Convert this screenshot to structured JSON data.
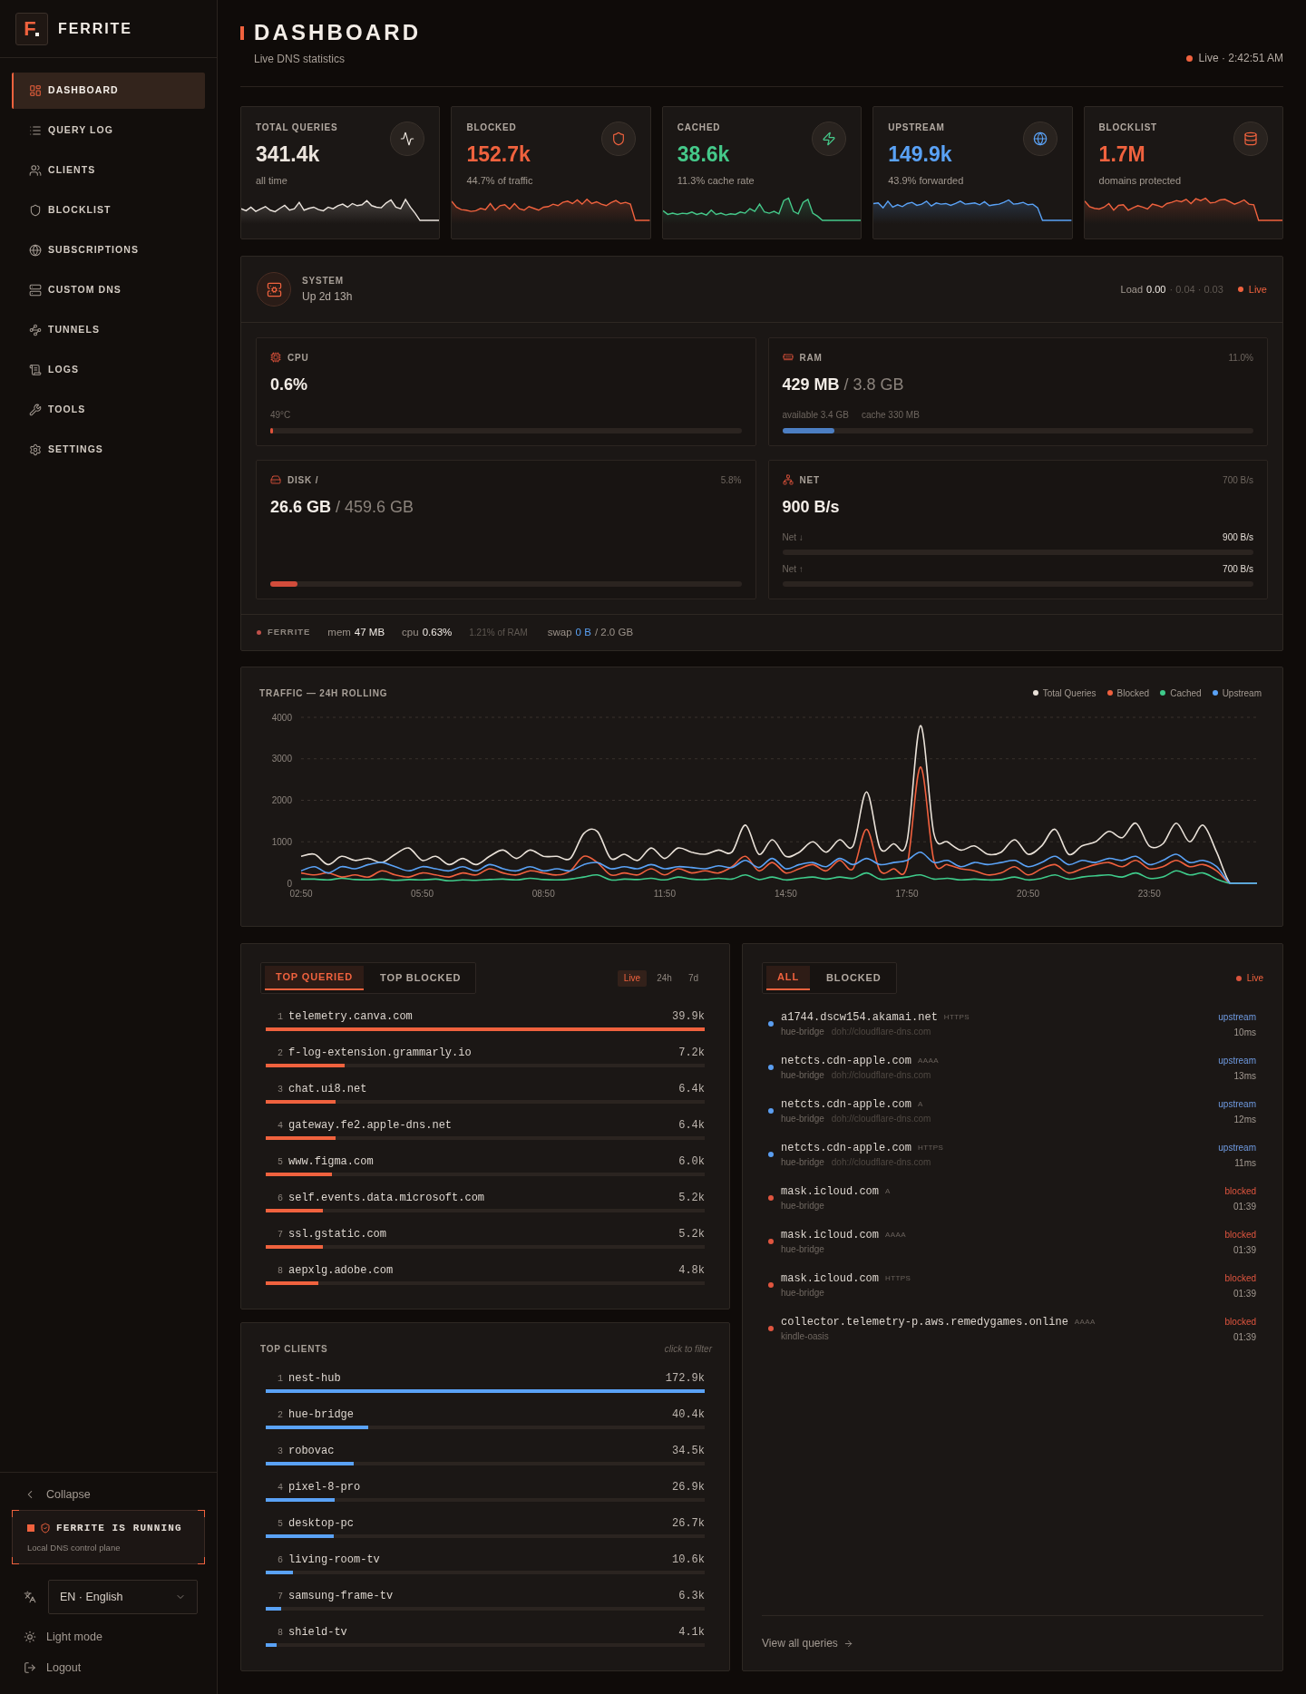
{
  "sidebar": {
    "brand": {
      "logo_letter": "F",
      "name": "FERRITE"
    },
    "nav": [
      {
        "label": "DASHBOARD",
        "selected": true
      },
      {
        "label": "QUERY LOG",
        "selected": false
      },
      {
        "label": "CLIENTS",
        "selected": false
      },
      {
        "label": "BLOCKLIST",
        "selected": false
      },
      {
        "label": "SUBSCRIPTIONS",
        "selected": false
      },
      {
        "label": "CUSTOM DNS",
        "selected": false
      },
      {
        "label": "TUNNELS",
        "selected": false
      },
      {
        "label": "LOGS",
        "selected": false
      },
      {
        "label": "TOOLS",
        "selected": false
      },
      {
        "label": "SETTINGS",
        "selected": false
      }
    ],
    "collapse": "Collapse",
    "status": {
      "title": "FERRITE IS RUNNING",
      "subtitle": "Local DNS control plane",
      "running": true
    },
    "language": {
      "value": "EN · English"
    },
    "theme_toggle": "Light mode",
    "logout": "Logout"
  },
  "header": {
    "title": "DASHBOARD",
    "subtitle": "Live DNS statistics",
    "live": "Live · 2:42:51 AM"
  },
  "stats": [
    {
      "label": "TOTAL QUERIES",
      "value": "341.4k",
      "note": "all time",
      "color": "#ece5de"
    },
    {
      "label": "BLOCKED",
      "value": "152.7k",
      "note": "44.7% of traffic",
      "color": "#f0623e"
    },
    {
      "label": "CACHED",
      "value": "38.6k",
      "note": "11.3% cache rate",
      "color": "#45c98a"
    },
    {
      "label": "UPSTREAM",
      "value": "149.9k",
      "note": "43.9% forwarded",
      "color": "#5aa2f6"
    },
    {
      "label": "BLOCKLIST",
      "value": "1.7M",
      "note": "domains protected",
      "color": "#f0623e"
    }
  ],
  "system": {
    "title": "SYSTEM",
    "uptime": "Up 2d 13h",
    "load": {
      "label": "Load",
      "current": "0.00",
      "rest": "· 0.04 · 0.03"
    },
    "live": "Live",
    "metrics": [
      {
        "kind": "gauge",
        "label": "CPU",
        "value": "0.6%",
        "notes": [
          "49°C"
        ],
        "level": 0.006,
        "color": "#e0533b"
      },
      {
        "kind": "gauge",
        "label": "RAM",
        "percent": "11.0%",
        "value": "429 MB",
        "total": "/ 3.8 GB",
        "notes": [
          "available 3.4 GB",
          "cache 330 MB"
        ],
        "level": 0.11,
        "color": "#4c7ec2"
      },
      {
        "kind": "gauge",
        "label": "DISK /",
        "percent": "5.8%",
        "value": "26.6 GB",
        "total": "/ 459.6 GB",
        "level": 0.058,
        "color": "#d24c3b"
      },
      {
        "kind": "rates",
        "label": "NET",
        "percent": "700 B/s",
        "value": "900 B/s",
        "rates": [
          {
            "label": "Net ↓",
            "reading": "900 B/s"
          },
          {
            "label": "Net ↑",
            "reading": "700 B/s"
          }
        ]
      }
    ],
    "process": {
      "name": "FERRITE",
      "stats": [
        {
          "label": "mem",
          "value": "47 MB"
        },
        {
          "label": "cpu",
          "value": "0.63%"
        }
      ],
      "note": "1.21% of RAM",
      "swap": {
        "label": "swap",
        "used": "0 B",
        "total": "/ 2.0 GB"
      }
    }
  },
  "traffic": {
    "chart_data": {
      "type": "line",
      "title": "TRAFFIC — 24H ROLLING",
      "grid": true,
      "categories": [
        "02:50",
        null,
        null,
        null,
        null,
        null,
        null,
        null,
        null,
        "05:50",
        null,
        null,
        null,
        null,
        null,
        null,
        null,
        null,
        "08:50",
        null,
        null,
        null,
        null,
        null,
        null,
        null,
        null,
        "11:50",
        null,
        null,
        null,
        null,
        null,
        null,
        null,
        null,
        "14:50",
        null,
        null,
        null,
        null,
        null,
        null,
        null,
        null,
        "17:50",
        null,
        null,
        null,
        null,
        null,
        null,
        null,
        null,
        "20:50",
        null,
        null,
        null,
        null,
        null,
        null,
        null,
        null,
        "23:50",
        null,
        null,
        null,
        null,
        null,
        null,
        null,
        null
      ],
      "ylim": [
        0,
        4000
      ],
      "yticks": [
        0,
        1000,
        2000,
        3000,
        4000
      ],
      "series": [
        {
          "name": "Total Queries",
          "color": "#e9e1d8",
          "values": [
            650,
            700,
            450,
            650,
            550,
            600,
            500,
            700,
            850,
            550,
            650,
            450,
            600,
            450,
            650,
            800,
            600,
            800,
            650,
            650,
            600,
            1200,
            1250,
            600,
            700,
            550,
            850,
            600,
            850,
            750,
            700,
            800,
            750,
            1400,
            700,
            1050,
            650,
            750,
            1000,
            750,
            1050,
            900,
            2200,
            850,
            950,
            1000,
            3800,
            1200,
            1000,
            800,
            900,
            700,
            750,
            1050,
            700,
            900,
            1300,
            700,
            900,
            1000,
            1250,
            1100,
            1450,
            900,
            950,
            1450,
            1000,
            1400,
            750,
            0,
            0,
            0
          ]
        },
        {
          "name": "Blocked",
          "color": "#f0603e",
          "values": [
            250,
            200,
            250,
            150,
            200,
            150,
            300,
            200,
            150,
            250,
            200,
            150,
            250,
            200,
            350,
            250,
            200,
            300,
            250,
            200,
            300,
            650,
            500,
            200,
            250,
            200,
            350,
            200,
            350,
            250,
            300,
            250,
            400,
            650,
            300,
            500,
            250,
            350,
            450,
            300,
            550,
            350,
            1300,
            300,
            350,
            400,
            2800,
            550,
            450,
            350,
            300,
            200,
            250,
            400,
            200,
            350,
            450,
            250,
            350,
            450,
            500,
            400,
            550,
            350,
            400,
            550,
            400,
            450,
            300,
            0,
            0,
            0
          ]
        },
        {
          "name": "Cached",
          "color": "#3fcb8b",
          "values": [
            100,
            100,
            80,
            120,
            90,
            80,
            100,
            70,
            90,
            80,
            100,
            60,
            80,
            70,
            90,
            100,
            80,
            120,
            90,
            80,
            100,
            150,
            200,
            80,
            100,
            90,
            120,
            80,
            150,
            100,
            90,
            120,
            100,
            200,
            90,
            150,
            80,
            120,
            150,
            100,
            150,
            120,
            250,
            100,
            120,
            150,
            200,
            100,
            120,
            80,
            100,
            80,
            90,
            150,
            80,
            120,
            200,
            100,
            150,
            180,
            200,
            150,
            250,
            120,
            150,
            300,
            200,
            250,
            100,
            0,
            0,
            0
          ]
        },
        {
          "name": "Upstream",
          "color": "#5aa2f6",
          "values": [
            300,
            400,
            250,
            400,
            350,
            450,
            500,
            400,
            300,
            400,
            350,
            300,
            400,
            300,
            450,
            350,
            300,
            400,
            300,
            350,
            300,
            450,
            500,
            350,
            400,
            350,
            450,
            350,
            400,
            380,
            350,
            420,
            380,
            550,
            380,
            600,
            350,
            450,
            500,
            400,
            600,
            450,
            600,
            450,
            500,
            550,
            750,
            500,
            550,
            400,
            500,
            450,
            500,
            550,
            400,
            500,
            650,
            450,
            550,
            500,
            600,
            550,
            650,
            450,
            550,
            700,
            500,
            550,
            400,
            0,
            0,
            0
          ]
        }
      ]
    }
  },
  "top_domains": {
    "tabs": [
      {
        "label": "TOP QUERIED",
        "selected": true
      },
      {
        "label": "TOP BLOCKED",
        "selected": false
      }
    ],
    "ranges": [
      {
        "label": "Live",
        "selected": true
      },
      {
        "label": "24h",
        "selected": false
      },
      {
        "label": "7d",
        "selected": false
      }
    ],
    "rows": [
      {
        "rank": "1",
        "name": "telemetry.canva.com",
        "count": "39.9k",
        "level": 1
      },
      {
        "rank": "2",
        "name": "f-log-extension.grammarly.io",
        "count": "7.2k",
        "level": 0.18
      },
      {
        "rank": "3",
        "name": "chat.ui8.net",
        "count": "6.4k",
        "level": 0.16
      },
      {
        "rank": "4",
        "name": "gateway.fe2.apple-dns.net",
        "count": "6.4k",
        "level": 0.16
      },
      {
        "rank": "5",
        "name": "www.figma.com",
        "count": "6.0k",
        "level": 0.15
      },
      {
        "rank": "6",
        "name": "self.events.data.microsoft.com",
        "count": "5.2k",
        "level": 0.13
      },
      {
        "rank": "7",
        "name": "ssl.gstatic.com",
        "count": "5.2k",
        "level": 0.13
      },
      {
        "rank": "8",
        "name": "aepxlg.adobe.com",
        "count": "4.8k",
        "level": 0.12
      }
    ]
  },
  "top_clients": {
    "title": "TOP CLIENTS",
    "hint": "click to filter",
    "rows": [
      {
        "rank": "1",
        "name": "nest-hub",
        "count": "172.9k",
        "level": 1
      },
      {
        "rank": "2",
        "name": "hue-bridge",
        "count": "40.4k",
        "level": 0.234
      },
      {
        "rank": "3",
        "name": "robovac",
        "count": "34.5k",
        "level": 0.2
      },
      {
        "rank": "4",
        "name": "pixel-8-pro",
        "count": "26.9k",
        "level": 0.156
      },
      {
        "rank": "5",
        "name": "desktop-pc",
        "count": "26.7k",
        "level": 0.155
      },
      {
        "rank": "6",
        "name": "living-room-tv",
        "count": "10.6k",
        "level": 0.061
      },
      {
        "rank": "7",
        "name": "samsung-frame-tv",
        "count": "6.3k",
        "level": 0.036
      },
      {
        "rank": "8",
        "name": "shield-tv",
        "count": "4.1k",
        "level": 0.024
      }
    ]
  },
  "query_log": {
    "tabs": [
      {
        "label": "ALL",
        "selected": true
      },
      {
        "label": "BLOCKED",
        "selected": false
      }
    ],
    "live": "Live",
    "entries": [
      {
        "domain": "a1744.dscw154.akamai.net",
        "type": "HTTPS",
        "client": "hue-bridge",
        "upstream": "doh://cloudflare-dns.com",
        "status": "upstream",
        "blocked": false,
        "time": "10ms"
      },
      {
        "domain": "netcts.cdn-apple.com",
        "type": "AAAA",
        "client": "hue-bridge",
        "upstream": "doh://cloudflare-dns.com",
        "status": "upstream",
        "blocked": false,
        "time": "13ms"
      },
      {
        "domain": "netcts.cdn-apple.com",
        "type": "A",
        "client": "hue-bridge",
        "upstream": "doh://cloudflare-dns.com",
        "status": "upstream",
        "blocked": false,
        "time": "12ms"
      },
      {
        "domain": "netcts.cdn-apple.com",
        "type": "HTTPS",
        "client": "hue-bridge",
        "upstream": "doh://cloudflare-dns.com",
        "status": "upstream",
        "blocked": false,
        "time": "11ms"
      },
      {
        "domain": "mask.icloud.com",
        "type": "A",
        "client": "hue-bridge",
        "status": "blocked",
        "blocked": true,
        "time": "01:39"
      },
      {
        "domain": "mask.icloud.com",
        "type": "AAAA",
        "client": "hue-bridge",
        "status": "blocked",
        "blocked": true,
        "time": "01:39"
      },
      {
        "domain": "mask.icloud.com",
        "type": "HTTPS",
        "client": "hue-bridge",
        "status": "blocked",
        "blocked": true,
        "time": "01:39"
      },
      {
        "domain": "collector.telemetry-p.aws.remedygames.online",
        "type": "AAAA",
        "client": "kindle-oasis",
        "status": "blocked",
        "blocked": true,
        "time": "01:39"
      }
    ],
    "footer_link": "View all queries"
  }
}
